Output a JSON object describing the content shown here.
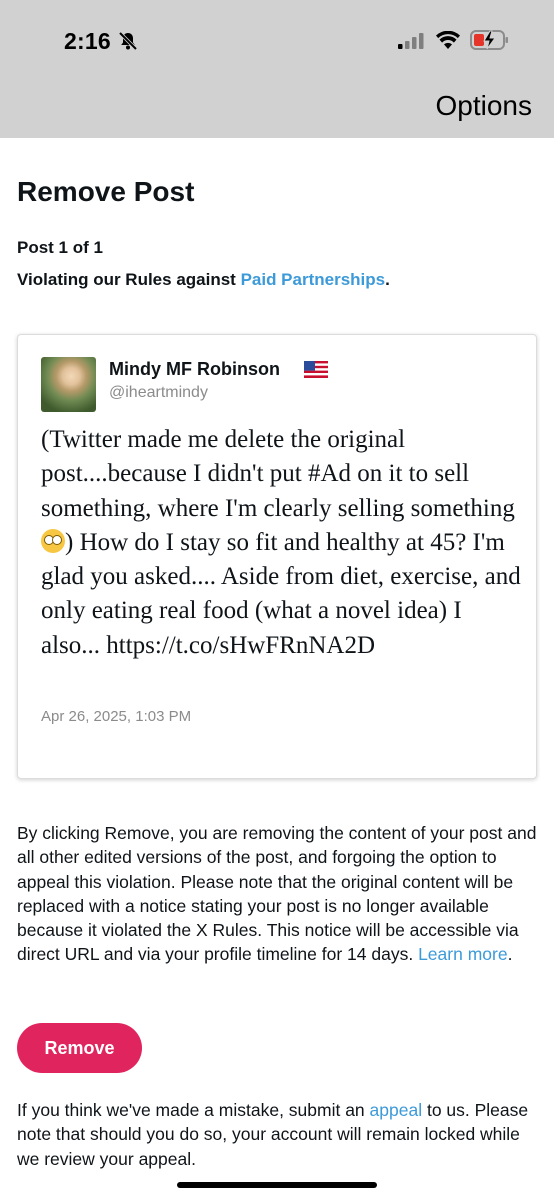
{
  "status_bar": {
    "time": "2:16",
    "icons": [
      "bell-slash-icon",
      "signal-icon",
      "wifi-icon",
      "battery-charging-icon"
    ]
  },
  "nav": {
    "options_label": "Options"
  },
  "page": {
    "title": "Remove Post",
    "post_count": "Post 1 of 1",
    "violation_prefix": "Violating our Rules against ",
    "violation_link": "Paid Partnerships",
    "violation_suffix": "."
  },
  "tweet": {
    "author_name": "Mindy MF Robinson",
    "author_flag": "flag-us-icon",
    "author_handle": "@iheartmindy",
    "text_part1": "(Twitter made me delete the original post....because I didn't put #Ad on it to sell something, where I'm clearly selling something ",
    "emoji": "eye-roll-emoji",
    "text_part2": ") How do I stay so fit and healthy at 45? I'm glad you asked.... Aside from diet, exercise, and only eating real food (what a novel idea) I also... https://t.co/sHwFRnNA2D",
    "date": "Apr 26, 2025, 1:03 PM"
  },
  "disclaimer": {
    "text": "By clicking Remove, you are removing the content of your post and all other edited versions of the post, and forgoing the option to appeal this violation. Please note that the original content will be replaced with a notice stating your post is no longer available because it violated the X Rules. This notice will be accessible via direct URL and via your profile timeline for 14 days. ",
    "learn_more": "Learn more",
    "suffix": "."
  },
  "remove_button": {
    "label": "Remove",
    "color": "#e0245e"
  },
  "appeal": {
    "prefix": "If you think we've made a mistake, submit an ",
    "link": "appeal",
    "suffix": " to us. Please note that should you do so, your account will remain locked while we review your appeal."
  },
  "colors": {
    "link": "#3d9ad9",
    "header_bg": "#d1d1d1"
  }
}
